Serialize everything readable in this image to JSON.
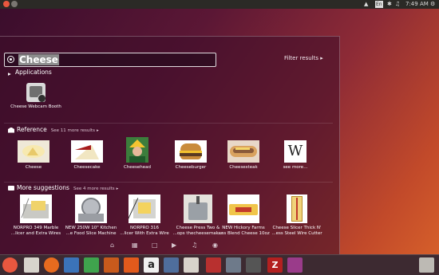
{
  "panel": {
    "time": "7:49 AM",
    "keyboard": "En"
  },
  "search": {
    "query": "Cheese",
    "filter_label": "Filter results"
  },
  "sections": {
    "applications": {
      "title": "Applications",
      "items": [
        {
          "label": "Cheese Webcam Booth"
        }
      ]
    },
    "reference": {
      "title": "Reference",
      "more": "See 11 more results",
      "items": [
        {
          "label": "Cheese"
        },
        {
          "label": "Cheesecake"
        },
        {
          "label": "Cheesehead"
        },
        {
          "label": "Cheeseburger"
        },
        {
          "label": "Cheesesteak"
        },
        {
          "label": "see more..."
        }
      ]
    },
    "suggestions": {
      "title": "More suggestions",
      "more": "See 4 more results",
      "items": [
        {
          "line1": "NORPRO 349 Marble",
          "line2": "...licer and Extra Wires"
        },
        {
          "line1": "NEW 250W 10\" Kitchen",
          "line2": "...e Food Slice Machine"
        },
        {
          "line1": "NORPRO 316",
          "line2": "...licer With Extra Wire"
        },
        {
          "line1": "Cheese Press Two &",
          "line2": "...ops thecheesemaker"
        },
        {
          "line1": "NEW Hickory Farms",
          "line2": "...ss Blend Cheese 10oz"
        },
        {
          "line1": "Cheese Slicer Thick N'",
          "line2": "...ess Steel Wire Cutter"
        }
      ]
    }
  },
  "icons": {
    "wikipedia_glyph": "W"
  },
  "colors": {
    "accent": "#e9573f",
    "launcher_bg": "#3d2a31"
  }
}
